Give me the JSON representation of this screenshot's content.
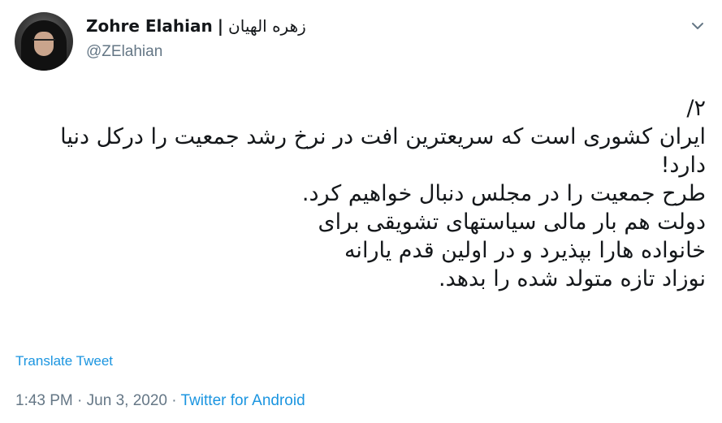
{
  "author": {
    "display_name": "Zohre Elahian",
    "separator": "|",
    "display_name_fa": "زهره الهیان",
    "handle": "@ZElahian"
  },
  "tweet": {
    "lines": [
      "۲/",
      "ایران کشوری است که سریعترین افت در نرخ رشد جمعیت را درکل دنیا",
      "دارد!",
      "طرح جمعیت را در مجلس دنبال خواهیم کرد.",
      "دولت هم بار مالی سیاستهای تشویقی برای",
      "خانواده هارا بپذیرد و در اولین قدم یارانه",
      "نوزاد تازه متولد شده را بدهد."
    ],
    "translate_label": "Translate Tweet"
  },
  "meta": {
    "time": "1:43 PM",
    "dot1": " · ",
    "date": "Jun 3, 2020",
    "dot2": " · ",
    "source": "Twitter for Android"
  },
  "icons": {
    "avatar": "profile-photo",
    "caret": "chevron-down-icon"
  },
  "colors": {
    "link": "#1b95e0",
    "secondary_text": "#657786",
    "primary_text": "#14171a"
  }
}
